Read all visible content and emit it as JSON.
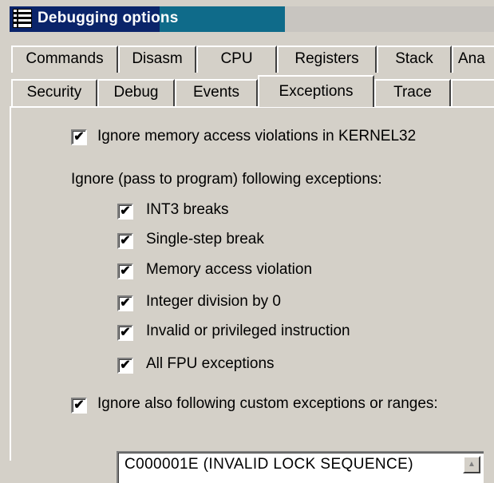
{
  "window": {
    "title": "Debugging options"
  },
  "tabs": {
    "row1": [
      "Commands",
      "Disasm",
      "CPU",
      "Registers",
      "Stack",
      "Ana"
    ],
    "row2": [
      "Security",
      "Debug",
      "Events",
      "Exceptions",
      "Trace"
    ],
    "active": "Exceptions"
  },
  "options": {
    "kernel32": {
      "label": "Ignore memory access violations in KERNEL32",
      "checked": true
    },
    "group_label": "Ignore (pass to program) following exceptions:",
    "items": [
      {
        "label": "INT3 breaks",
        "checked": true
      },
      {
        "label": "Single-step break",
        "checked": true
      },
      {
        "label": "Memory access violation",
        "checked": true
      },
      {
        "label": "Integer division by 0",
        "checked": true
      },
      {
        "label": "Invalid or privileged instruction",
        "checked": true
      },
      {
        "label": "All FPU exceptions",
        "checked": true
      }
    ],
    "custom": {
      "label": "Ignore also following custom exceptions or ranges:",
      "checked": true
    }
  },
  "custom_list": {
    "entries": [
      "C000001E (INVALID LOCK SEQUENCE)"
    ]
  },
  "check_glyph": "✔"
}
